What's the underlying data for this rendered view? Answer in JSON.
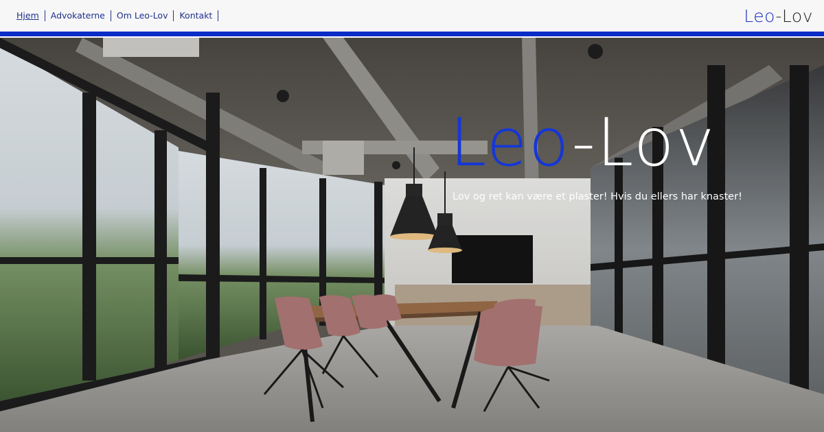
{
  "nav": {
    "items": [
      {
        "label": "Hjem"
      },
      {
        "label": "Advokaterne"
      },
      {
        "label": "Om Leo-Lov"
      },
      {
        "label": "Kontakt"
      }
    ]
  },
  "brand": {
    "part1": "Leo",
    "part2": "-Lov"
  },
  "hero": {
    "title_part1": "Leo",
    "title_part2": "-Lov",
    "subtitle": "Lov og ret kan være et plaster! Hvis du ellers har knaster!"
  },
  "colors": {
    "accent_blue": "#0a2cc7",
    "nav_text": "#1f2f8a",
    "title_blue": "#1536d6"
  }
}
